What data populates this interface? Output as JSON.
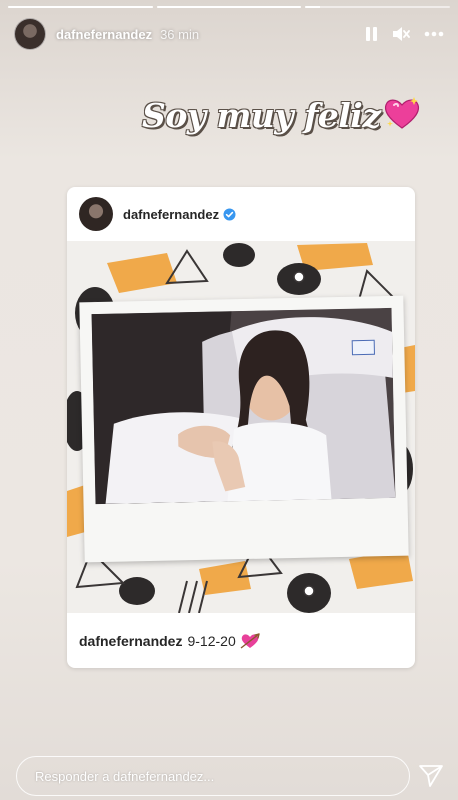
{
  "story": {
    "progress": {
      "segments": 3,
      "active_index": 2,
      "active_fraction": 0.1
    },
    "header": {
      "username": "dafnefernandez",
      "time": "36 min",
      "icons": [
        "avatar",
        "pause-icon",
        "mute-icon",
        "more-icon"
      ]
    },
    "caption": {
      "text": "Soy muy feliz",
      "emoji": "sparkling-heart-icon"
    },
    "post": {
      "username": "dafnefernandez",
      "verified": true,
      "caption_user": "dafnefernandez",
      "caption_text": "9-12-20",
      "caption_emoji": "heart-with-arrow-icon"
    },
    "reply": {
      "placeholder": "Responder a dafnefernandez..."
    },
    "colors": {
      "accent_verified": "#3897f0",
      "heart": "#e8409a"
    }
  }
}
